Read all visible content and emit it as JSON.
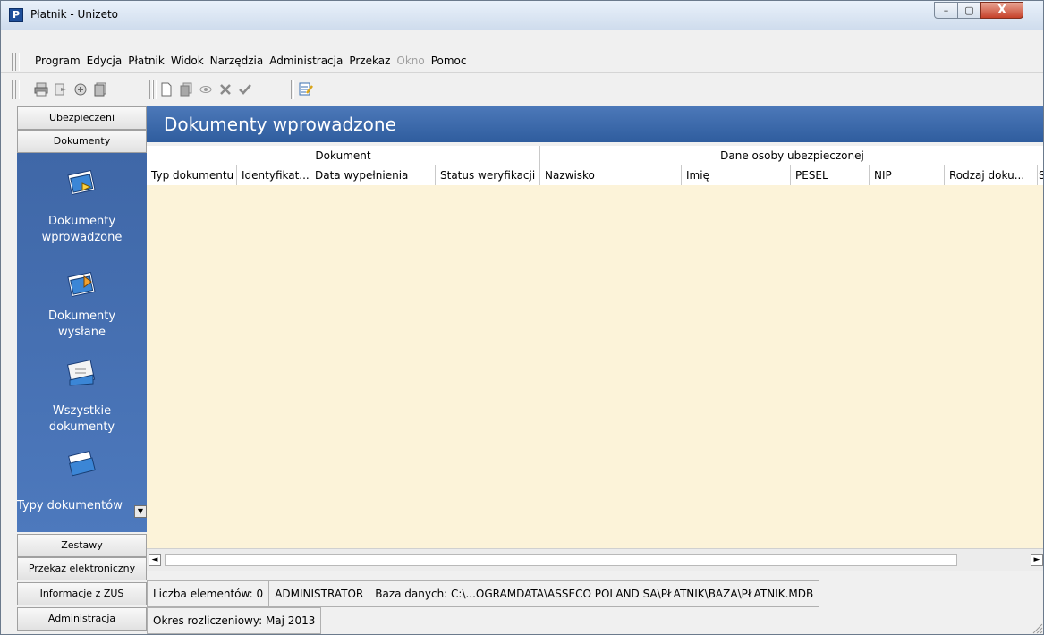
{
  "window": {
    "title": "Płatnik - Unizeto",
    "app_icon_letter": "P",
    "controls": {
      "minimize": "–",
      "maximize": "▢",
      "close": "X"
    }
  },
  "menu": {
    "items": [
      {
        "label": "Program",
        "enabled": true
      },
      {
        "label": "Edycja",
        "enabled": true
      },
      {
        "label": "Płatnik",
        "enabled": true
      },
      {
        "label": "Widok",
        "enabled": true
      },
      {
        "label": "Narzędzia",
        "enabled": true
      },
      {
        "label": "Administracja",
        "enabled": true
      },
      {
        "label": "Przekaz",
        "enabled": true
      },
      {
        "label": "Okno",
        "enabled": false
      },
      {
        "label": "Pomoc",
        "enabled": true
      }
    ]
  },
  "toolbar": {
    "group1": [
      "print-icon",
      "export-icon",
      "import-icon",
      "documents-icon"
    ],
    "group2": [
      "new-document-icon",
      "copy-document-icon",
      "view-icon",
      "delete-icon",
      "verify-check-icon"
    ],
    "group3": [
      "edit-document-icon"
    ]
  },
  "sidebar": {
    "tabs_top": [
      "Ubezpieczeni",
      "Dokumenty"
    ],
    "entries": [
      {
        "label1": "Dokumenty",
        "label2": "wprowadzone",
        "icon": "documents-entered-icon"
      },
      {
        "label1": "Dokumenty",
        "label2": "wysłane",
        "icon": "documents-sent-icon"
      },
      {
        "label1": "Wszystkie",
        "label2": "dokumenty",
        "icon": "all-documents-icon"
      },
      {
        "label1": "Typy dokumentów",
        "label2": "",
        "icon": "document-types-icon"
      }
    ],
    "tabs_bottom": [
      "Zestawy",
      "Przekaz elektroniczny",
      "Informacje z ZUS",
      "Administracja"
    ]
  },
  "content": {
    "title": "Dokumenty wprowadzone",
    "groups": [
      "Dokument",
      "Dane osoby ubezpieczonej"
    ],
    "columns": [
      "Typ dokumentu",
      "Identyfikat...",
      "Data wypełnienia",
      "Status weryfikacji",
      "Nazwisko",
      "Imię",
      "PESEL",
      "NIP",
      "Rodzaj doku...",
      "S"
    ]
  },
  "hscroll": {
    "left": "◄",
    "right": "►"
  },
  "status": {
    "count": "Liczba elementów: 0",
    "user": "ADMINISTRATOR",
    "database": "Baza danych: C:\\...OGRAMDATA\\ASSECO POLAND SA\\PŁATNIK\\BAZA\\PŁATNIK.MDB",
    "period": "Okres rozliczeniowy: Maj 2013"
  },
  "colors": {
    "accent_blue": "#2f5d9e",
    "sidebar_blue": "#4d79bd",
    "grid_background": "#fcf3d9"
  }
}
